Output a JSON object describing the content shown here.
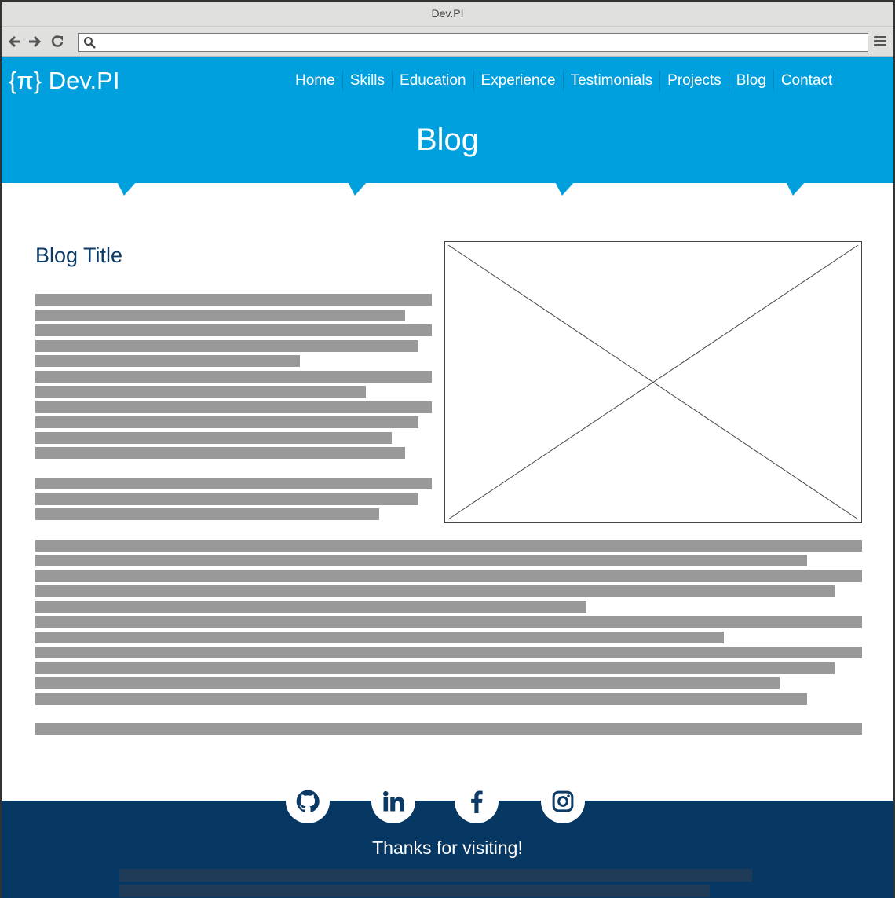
{
  "browser": {
    "window_title": "Dev.PI",
    "url": "",
    "back_icon": "arrow-left-icon",
    "forward_icon": "arrow-right-icon",
    "reload_icon": "reload-icon",
    "search_icon": "search-icon",
    "menu_icon": "hamburger-menu-icon"
  },
  "site": {
    "logo_text": "{π} Dev.PI",
    "nav": [
      "Home",
      "Skills",
      "Education",
      "Experience",
      "Testimonials",
      "Projects",
      "Blog",
      "Contact"
    ],
    "page_heading": "Blog"
  },
  "article": {
    "title": "Blog Title",
    "image_placeholder": "image-placeholder"
  },
  "footer": {
    "social": [
      "github-icon",
      "linkedin-icon",
      "facebook-icon",
      "instagram-icon"
    ],
    "thanks": "Thanks for visiting!"
  },
  "colors": {
    "header_blue": "#009fdd",
    "title_navy": "#0b3a66",
    "footer_navy": "#073763",
    "text_placeholder_gray": "#999999"
  }
}
